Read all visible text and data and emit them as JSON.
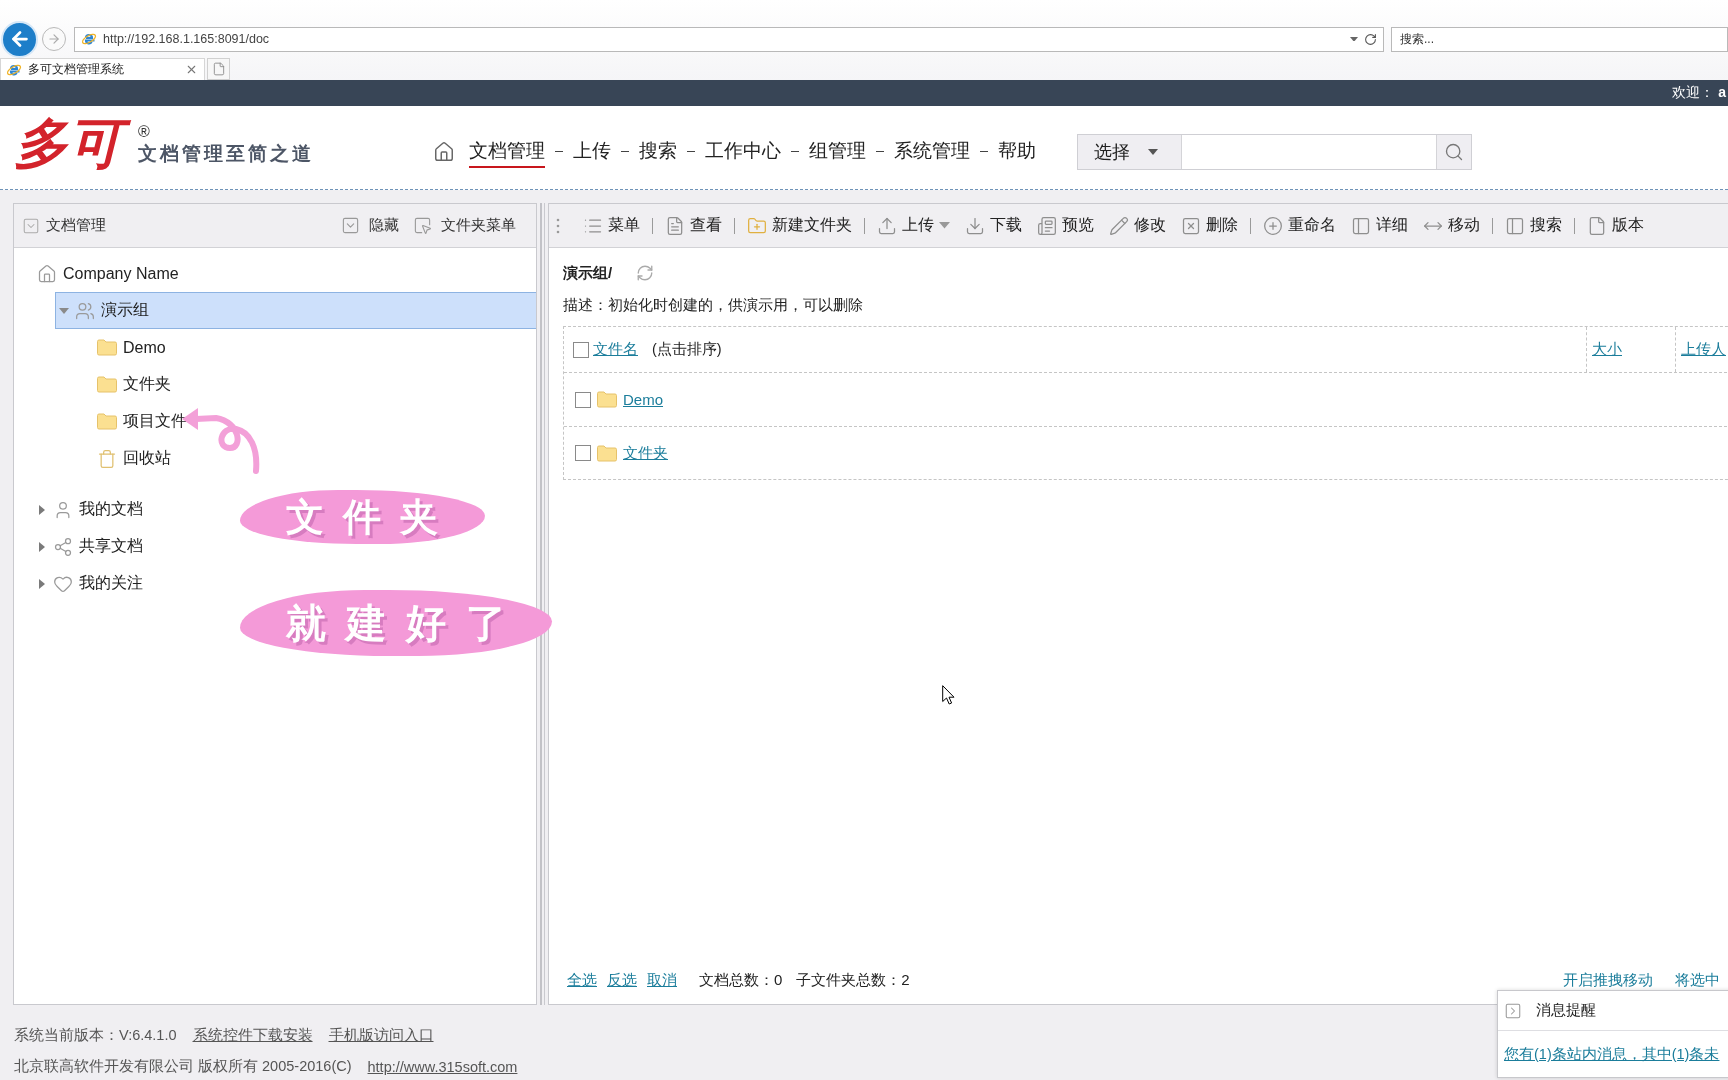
{
  "browser": {
    "url": "http://192.168.1.165:8091/doc",
    "search_placeholder": "搜索...",
    "tab_title": "多可文档管理系统"
  },
  "top_bar": {
    "welcome": "欢迎： **a**"
  },
  "header": {
    "logo": "多可",
    "trademark": "®",
    "tagline": "文档管理至简之道",
    "nav": [
      {
        "label": "文档管理",
        "selected": true
      },
      {
        "label": "上传",
        "selected": false
      },
      {
        "label": "搜索",
        "selected": false
      },
      {
        "label": "工作中心",
        "selected": false
      },
      {
        "label": "组管理",
        "selected": false
      },
      {
        "label": "系统管理",
        "selected": false
      },
      {
        "label": "帮助",
        "selected": false
      }
    ],
    "search": {
      "scope": "选择"
    }
  },
  "sidebar": {
    "title": "文档管理",
    "actions": [
      {
        "label": "隐藏",
        "kind": "hide"
      },
      {
        "label": "文件夹菜单",
        "kind": "folder_menu"
      }
    ],
    "tree": [
      {
        "label": "Company Name",
        "kind": "home",
        "selected": false,
        "children": [
          {
            "label": "演示组",
            "kind": "group",
            "expanded": true,
            "selected": true,
            "children": [
              {
                "label": "Demo",
                "kind": "folder",
                "selected": false
              },
              {
                "label": "文件夹",
                "kind": "folder",
                "selected": false
              },
              {
                "label": "项目文件",
                "kind": "folder",
                "selected": false
              },
              {
                "label": "回收站",
                "kind": "trash",
                "selected": false
              }
            ]
          }
        ]
      },
      {
        "label": "我的文档",
        "kind": "user",
        "expanded": false,
        "selected": false
      },
      {
        "label": "共享文档",
        "kind": "share",
        "expanded": false,
        "selected": false
      },
      {
        "label": "我的关注",
        "kind": "heart",
        "expanded": false,
        "selected": false
      }
    ]
  },
  "toolbar": [
    [
      {
        "label": "菜单",
        "kind": "menu",
        "dropdown": false
      }
    ],
    [
      {
        "label": "查看",
        "kind": "view",
        "dropdown": false
      }
    ],
    [
      {
        "label": "新建文件夹",
        "kind": "new_folder",
        "dropdown": false
      }
    ],
    [
      {
        "label": "上传",
        "kind": "upload",
        "dropdown": true
      },
      {
        "label": "下载",
        "kind": "download",
        "dropdown": false
      },
      {
        "label": "预览",
        "kind": "preview",
        "dropdown": false
      },
      {
        "label": "修改",
        "kind": "edit",
        "dropdown": false
      },
      {
        "label": "删除",
        "kind": "delete",
        "dropdown": false
      }
    ],
    [
      {
        "label": "重命名",
        "kind": "rename",
        "dropdown": false
      },
      {
        "label": "详细",
        "kind": "details",
        "dropdown": false
      },
      {
        "label": "移动",
        "kind": "move",
        "dropdown": false
      }
    ],
    [
      {
        "label": "搜索",
        "kind": "search",
        "dropdown": false
      }
    ],
    [
      {
        "label": "版本",
        "kind": "version",
        "dropdown": false
      }
    ]
  ],
  "folder": {
    "path": "演示组/",
    "description": "描述：初始化时创建的，供演示用，可以删除"
  },
  "table": {
    "select_all": {
      "checked": false
    },
    "columns": [
      {
        "label": "文件名",
        "note": "(点击排序)"
      },
      {
        "label": "大小"
      },
      {
        "label": "上传人"
      }
    ],
    "rows": [
      {
        "name": "Demo",
        "checked": false
      },
      {
        "name": "文件夹",
        "checked": false
      }
    ]
  },
  "list_footer": {
    "selection_links": [
      "全选",
      "反选",
      "取消"
    ],
    "stats": [
      "文档总数：0",
      "子文件夹总数：2"
    ],
    "actions": [
      "开启推拽移动",
      "将选中"
    ]
  },
  "page_footer": {
    "version": "系统当前版本：V:6.4.1.0",
    "links": [
      "系统控件下载安装",
      "手机版访问入口"
    ],
    "copyright": "北京联高软件开发有限公司 版权所有 2005-2016(C)",
    "website": "http://www.315soft.com"
  },
  "notification": {
    "title": "消息提醒",
    "message": "您有(1)条站内消息，其中(1)条未"
  },
  "annotation": {
    "captions": [
      "文件夹",
      "就建好了"
    ]
  }
}
